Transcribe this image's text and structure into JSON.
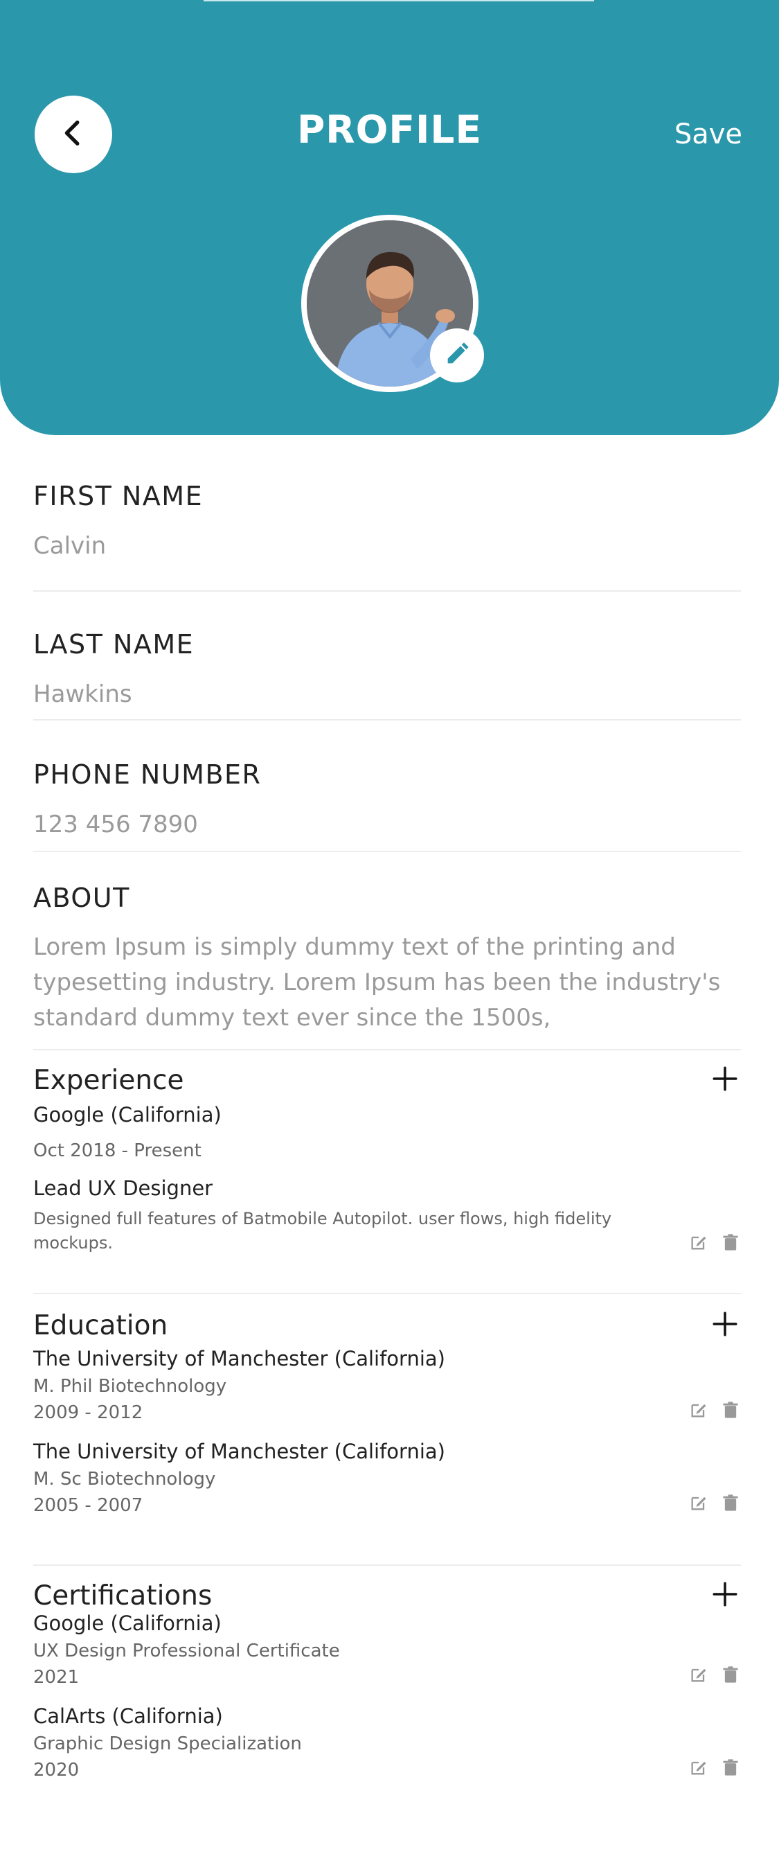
{
  "header": {
    "title": "PROFILE",
    "save_label": "Save",
    "back_icon": "chevron-left-icon",
    "edit_photo_icon": "pencil-icon",
    "background_color": "#2a97ab"
  },
  "fields": {
    "first_name": {
      "label": "FIRST NAME",
      "value": "Calvin"
    },
    "last_name": {
      "label": "LAST NAME",
      "value": "Hawkins"
    },
    "phone": {
      "label": "PHONE NUMBER",
      "value": "123 456 7890"
    },
    "about": {
      "label": "ABOUT",
      "value": "Lorem Ipsum is simply dummy text of the printing and typesetting industry. Lorem Ipsum has been the industry's standard dummy text ever since the 1500s,"
    }
  },
  "experience": {
    "title": "Experience",
    "items": [
      {
        "org": "Google (California)",
        "dates": "Oct 2018 - Present",
        "role": "Lead UX Designer",
        "description": "Designed full features of Batmobile Autopilot. user flows, high fidelity mockups."
      }
    ]
  },
  "education": {
    "title": "Education",
    "items": [
      {
        "org": "The University of Manchester (California)",
        "degree": "M. Phil Biotechnology",
        "years": "2009 - 2012"
      },
      {
        "org": "The University of Manchester (California)",
        "degree": "M. Sc Biotechnology",
        "years": "2005 - 2007"
      }
    ]
  },
  "certifications": {
    "title": "Certifications",
    "items": [
      {
        "org": "Google (California)",
        "name": "UX Design Professional Certificate",
        "year": "2021"
      },
      {
        "org": "CalArts (California)",
        "name": "Graphic Design Specialization",
        "year": "2020"
      }
    ]
  },
  "icons": {
    "add": "plus-icon",
    "edit": "edit-icon",
    "delete": "trash-icon"
  }
}
